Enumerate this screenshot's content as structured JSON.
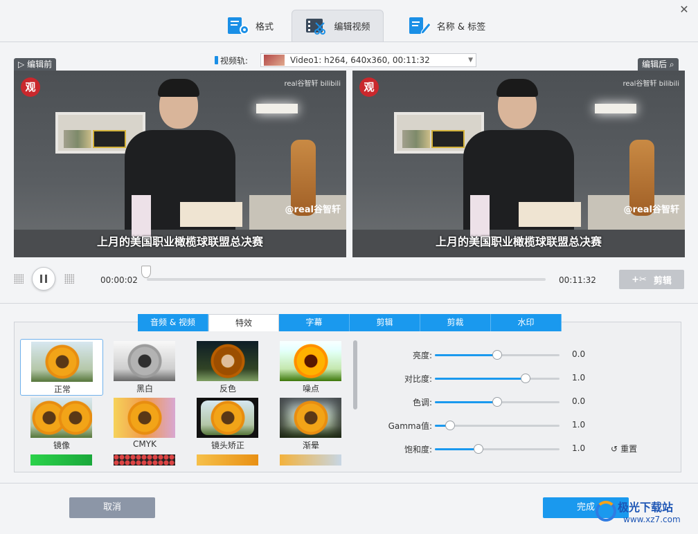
{
  "header": {
    "tabs": [
      {
        "label": "格式",
        "icon": "format-settings-icon"
      },
      {
        "label": "编辑视频",
        "icon": "video-edit-icon"
      },
      {
        "label": "名称 & 标签",
        "icon": "rename-tag-icon"
      }
    ],
    "active_tab": 1,
    "close_icon": "close-icon"
  },
  "track": {
    "label": "视频轨:",
    "value": "Video1: h264, 640x360, 00:11:32"
  },
  "preview": {
    "before_label": "编辑前",
    "after_label": "编辑后",
    "channel_logo": "观",
    "watermark": "real谷智轩 bilibili",
    "handle": "@real谷智轩",
    "subtitle": "上月的美国职业橄榄球联盟总决赛"
  },
  "player": {
    "current_time": "00:00:02",
    "total_time": "00:11:32",
    "progress": 0.0,
    "cut_label": "剪辑"
  },
  "sub_tabs": [
    {
      "label": "音频 & 视频"
    },
    {
      "label": "特效"
    },
    {
      "label": "字幕"
    },
    {
      "label": "剪辑"
    },
    {
      "label": "剪裁"
    },
    {
      "label": "水印"
    }
  ],
  "active_sub_tab": 1,
  "effects": [
    {
      "label": "正常",
      "selected": true
    },
    {
      "label": "黑白",
      "selected": false
    },
    {
      "label": "反色",
      "selected": false
    },
    {
      "label": "噪点",
      "selected": false
    },
    {
      "label": "镜像",
      "selected": false
    },
    {
      "label": "CMYK",
      "selected": false
    },
    {
      "label": "镜头矫正",
      "selected": false
    },
    {
      "label": "渐晕",
      "selected": false
    }
  ],
  "adjustments": [
    {
      "label": "亮度:",
      "value": "0.0",
      "level": 0.5
    },
    {
      "label": "对比度:",
      "value": "1.0",
      "level": 0.73
    },
    {
      "label": "色调:",
      "value": "0.0",
      "level": 0.5
    },
    {
      "label": "Gamma值:",
      "value": "1.0",
      "level": 0.12
    },
    {
      "label": "饱和度:",
      "value": "1.0",
      "level": 0.35
    }
  ],
  "reset_label": "重置",
  "footer": {
    "cancel_label": "取消",
    "done_label": "完成"
  },
  "site_watermark": {
    "line1": "极光下载站",
    "line2": "www.xz7.com"
  },
  "colors": {
    "accent": "#1a99ee",
    "cancel": "#8c96a7",
    "disabled": "#c3c6cb"
  }
}
